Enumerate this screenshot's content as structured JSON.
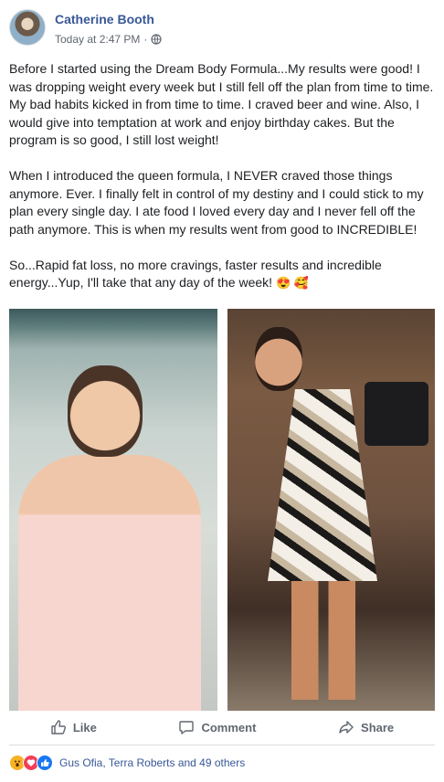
{
  "post": {
    "author": "Catherine Booth",
    "timestamp": "Today at 2:47 PM",
    "separator": "·",
    "paragraphs": [
      "Before I started using the Dream Body Formula...My results were good! I was dropping weight every week but I still fell off the plan from time to time. My bad habits kicked in from time to time. I craved beer and wine. Also, I would give into temptation at work and enjoy birthday cakes. But the program is so good, I still lost weight!",
      "When I introduced the queen formula, I NEVER craved those things anymore. Ever. I finally felt in control of my destiny and I could stick to my plan every single day. I ate food I loved every day and I never fell off the path anymore. This is when my results went from good to INCREDIBLE!",
      "So...Rapid fat loss, no more cravings, faster results and incredible energy...Yup, I'll take that any day of the week!"
    ],
    "emojis": "😍 🥰"
  },
  "actions": {
    "like": "Like",
    "comment": "Comment",
    "share": "Share"
  },
  "reactions": {
    "icons": [
      "wow-reaction-icon",
      "love-reaction-icon",
      "like-reaction-icon"
    ],
    "names": "Gus Ofia, Terra Roberts and 49 others"
  },
  "colors": {
    "link": "#385898",
    "meta": "#606770",
    "like_blue": "#1877f2",
    "love_red": "#f33e58",
    "wow_yellow": "#f7b125"
  }
}
